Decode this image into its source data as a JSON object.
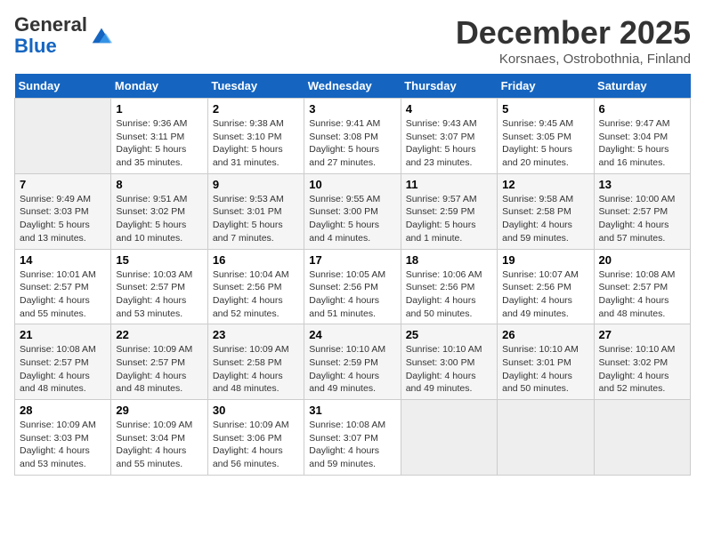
{
  "header": {
    "logo_general": "General",
    "logo_blue": "Blue",
    "month": "December 2025",
    "location": "Korsnaes, Ostrobothnia, Finland"
  },
  "weekdays": [
    "Sunday",
    "Monday",
    "Tuesday",
    "Wednesday",
    "Thursday",
    "Friday",
    "Saturday"
  ],
  "weeks": [
    [
      {
        "day": "",
        "text": ""
      },
      {
        "day": "1",
        "text": "Sunrise: 9:36 AM\nSunset: 3:11 PM\nDaylight: 5 hours\nand 35 minutes."
      },
      {
        "day": "2",
        "text": "Sunrise: 9:38 AM\nSunset: 3:10 PM\nDaylight: 5 hours\nand 31 minutes."
      },
      {
        "day": "3",
        "text": "Sunrise: 9:41 AM\nSunset: 3:08 PM\nDaylight: 5 hours\nand 27 minutes."
      },
      {
        "day": "4",
        "text": "Sunrise: 9:43 AM\nSunset: 3:07 PM\nDaylight: 5 hours\nand 23 minutes."
      },
      {
        "day": "5",
        "text": "Sunrise: 9:45 AM\nSunset: 3:05 PM\nDaylight: 5 hours\nand 20 minutes."
      },
      {
        "day": "6",
        "text": "Sunrise: 9:47 AM\nSunset: 3:04 PM\nDaylight: 5 hours\nand 16 minutes."
      }
    ],
    [
      {
        "day": "7",
        "text": "Sunrise: 9:49 AM\nSunset: 3:03 PM\nDaylight: 5 hours\nand 13 minutes."
      },
      {
        "day": "8",
        "text": "Sunrise: 9:51 AM\nSunset: 3:02 PM\nDaylight: 5 hours\nand 10 minutes."
      },
      {
        "day": "9",
        "text": "Sunrise: 9:53 AM\nSunset: 3:01 PM\nDaylight: 5 hours\nand 7 minutes."
      },
      {
        "day": "10",
        "text": "Sunrise: 9:55 AM\nSunset: 3:00 PM\nDaylight: 5 hours\nand 4 minutes."
      },
      {
        "day": "11",
        "text": "Sunrise: 9:57 AM\nSunset: 2:59 PM\nDaylight: 5 hours\nand 1 minute."
      },
      {
        "day": "12",
        "text": "Sunrise: 9:58 AM\nSunset: 2:58 PM\nDaylight: 4 hours\nand 59 minutes."
      },
      {
        "day": "13",
        "text": "Sunrise: 10:00 AM\nSunset: 2:57 PM\nDaylight: 4 hours\nand 57 minutes."
      }
    ],
    [
      {
        "day": "14",
        "text": "Sunrise: 10:01 AM\nSunset: 2:57 PM\nDaylight: 4 hours\nand 55 minutes."
      },
      {
        "day": "15",
        "text": "Sunrise: 10:03 AM\nSunset: 2:57 PM\nDaylight: 4 hours\nand 53 minutes."
      },
      {
        "day": "16",
        "text": "Sunrise: 10:04 AM\nSunset: 2:56 PM\nDaylight: 4 hours\nand 52 minutes."
      },
      {
        "day": "17",
        "text": "Sunrise: 10:05 AM\nSunset: 2:56 PM\nDaylight: 4 hours\nand 51 minutes."
      },
      {
        "day": "18",
        "text": "Sunrise: 10:06 AM\nSunset: 2:56 PM\nDaylight: 4 hours\nand 50 minutes."
      },
      {
        "day": "19",
        "text": "Sunrise: 10:07 AM\nSunset: 2:56 PM\nDaylight: 4 hours\nand 49 minutes."
      },
      {
        "day": "20",
        "text": "Sunrise: 10:08 AM\nSunset: 2:57 PM\nDaylight: 4 hours\nand 48 minutes."
      }
    ],
    [
      {
        "day": "21",
        "text": "Sunrise: 10:08 AM\nSunset: 2:57 PM\nDaylight: 4 hours\nand 48 minutes."
      },
      {
        "day": "22",
        "text": "Sunrise: 10:09 AM\nSunset: 2:57 PM\nDaylight: 4 hours\nand 48 minutes."
      },
      {
        "day": "23",
        "text": "Sunrise: 10:09 AM\nSunset: 2:58 PM\nDaylight: 4 hours\nand 48 minutes."
      },
      {
        "day": "24",
        "text": "Sunrise: 10:10 AM\nSunset: 2:59 PM\nDaylight: 4 hours\nand 49 minutes."
      },
      {
        "day": "25",
        "text": "Sunrise: 10:10 AM\nSunset: 3:00 PM\nDaylight: 4 hours\nand 49 minutes."
      },
      {
        "day": "26",
        "text": "Sunrise: 10:10 AM\nSunset: 3:01 PM\nDaylight: 4 hours\nand 50 minutes."
      },
      {
        "day": "27",
        "text": "Sunrise: 10:10 AM\nSunset: 3:02 PM\nDaylight: 4 hours\nand 52 minutes."
      }
    ],
    [
      {
        "day": "28",
        "text": "Sunrise: 10:09 AM\nSunset: 3:03 PM\nDaylight: 4 hours\nand 53 minutes."
      },
      {
        "day": "29",
        "text": "Sunrise: 10:09 AM\nSunset: 3:04 PM\nDaylight: 4 hours\nand 55 minutes."
      },
      {
        "day": "30",
        "text": "Sunrise: 10:09 AM\nSunset: 3:06 PM\nDaylight: 4 hours\nand 56 minutes."
      },
      {
        "day": "31",
        "text": "Sunrise: 10:08 AM\nSunset: 3:07 PM\nDaylight: 4 hours\nand 59 minutes."
      },
      {
        "day": "",
        "text": ""
      },
      {
        "day": "",
        "text": ""
      },
      {
        "day": "",
        "text": ""
      }
    ]
  ]
}
